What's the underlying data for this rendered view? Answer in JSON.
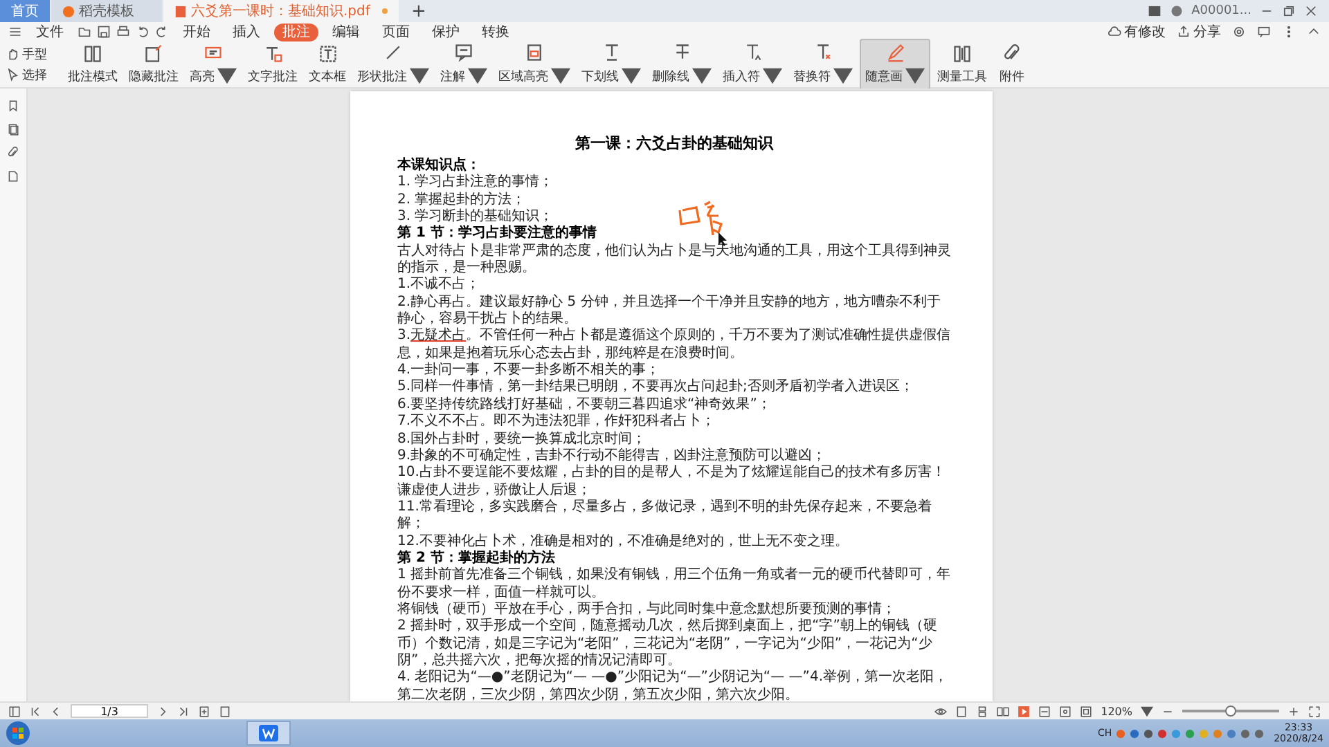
{
  "tabs": [
    {
      "label": "首页",
      "kind": "home",
      "selected": false
    },
    {
      "label": "稻壳模板",
      "kind": "template",
      "selected": false
    },
    {
      "label": "六爻第一课时：基础知识.pdf",
      "kind": "document",
      "selected": true
    }
  ],
  "new_tab": "+",
  "account": {
    "name": "A00001..."
  },
  "menu": {
    "label": "文件"
  },
  "ribbon_tabs": [
    {
      "label": "开始",
      "selected": false
    },
    {
      "label": "插入",
      "selected": false
    },
    {
      "label": "批注",
      "selected": true
    },
    {
      "label": "编辑",
      "selected": false
    },
    {
      "label": "页面",
      "selected": false
    },
    {
      "label": "保护",
      "selected": false
    },
    {
      "label": "转换",
      "selected": false
    }
  ],
  "right_actions": [
    {
      "label": "有修改"
    },
    {
      "label": "分享"
    }
  ],
  "small_tools": [
    {
      "label": "手型"
    },
    {
      "label": "选择"
    }
  ],
  "tools": [
    {
      "label": "批注模式",
      "dropdown": false,
      "selected": false
    },
    {
      "label": "隐藏批注",
      "dropdown": false,
      "selected": false
    },
    {
      "label": "高亮",
      "dropdown": true,
      "selected": false
    },
    {
      "label": "文字批注",
      "dropdown": false,
      "selected": false
    },
    {
      "label": "文本框",
      "dropdown": false,
      "selected": false
    },
    {
      "label": "形状批注",
      "dropdown": true,
      "selected": false
    },
    {
      "label": "注解",
      "dropdown": true,
      "selected": false
    },
    {
      "label": "区域高亮",
      "dropdown": true,
      "selected": false
    },
    {
      "label": "下划线",
      "dropdown": true,
      "selected": false
    },
    {
      "label": "删除线",
      "dropdown": true,
      "selected": false
    },
    {
      "label": "插入符",
      "dropdown": true,
      "selected": false
    },
    {
      "label": "替换符",
      "dropdown": true,
      "selected": false
    },
    {
      "label": "随意画",
      "dropdown": true,
      "selected": true
    },
    {
      "label": "测量工具",
      "dropdown": false,
      "selected": false
    },
    {
      "label": "附件",
      "dropdown": false,
      "selected": false
    }
  ],
  "document": {
    "title": "第一课：六爻占卦的基础知识",
    "blocks": [
      {
        "kind": "heading",
        "text": "本课知识点："
      },
      {
        "kind": "para",
        "text": "1.  学习占卦注意的事情；"
      },
      {
        "kind": "para",
        "text": "2.  掌握起卦的方法；"
      },
      {
        "kind": "para",
        "text": "3.  学习断卦的基础知识；"
      },
      {
        "kind": "heading",
        "text": "第 1 节：学习占卦要注意的事情"
      },
      {
        "kind": "para",
        "text": "古人对待占卜是非常严肃的态度，他们认为占卜是与天地沟通的工具，用这个工具得到神灵的指示，是一种恩赐。"
      },
      {
        "kind": "para",
        "text": "1.不诚不占；"
      },
      {
        "kind": "para",
        "text": "2.静心再占。建议最好静心 5 分钟，并且选择一个干净并且安静的地方，地方嘈杂不利于静心，容易干扰占卜的结果。"
      },
      {
        "kind": "marked",
        "prefix": "3.",
        "marked": "无疑术占",
        "text": "。不管任何一种占卜都是遵循这个原则的，千万不要为了测试准确性提供虚假信息，如果是抱着玩乐心态去占卦，那纯粹是在浪费时间。"
      },
      {
        "kind": "para",
        "text": "4.一卦问一事，不要一卦多断不相关的事；"
      },
      {
        "kind": "para",
        "text": "5.同样一件事情，第一卦结果已明朗，不要再次占问起卦;否则矛盾初学者入进误区；"
      },
      {
        "kind": "para",
        "text": "6.要坚持传统路线打好基础，不要朝三暮四追求“神奇效果”；"
      },
      {
        "kind": "para",
        "text": "7.不义不不占。即不为违法犯罪，作奸犯科者占卜；"
      },
      {
        "kind": "para",
        "text": "8.国外占卦时，要统一换算成北京时间；"
      },
      {
        "kind": "para",
        "text": "9.卦象的不可确定性，吉卦不行动不能得吉，凶卦注意预防可以避凶；"
      },
      {
        "kind": "para",
        "text": "10.占卦不要逞能不要炫耀，占卦的目的是帮人，不是为了炫耀逞能自己的技术有多厉害！谦虚使人进步，骄傲让人后退；"
      },
      {
        "kind": "para",
        "text": "11.常看理论，多实践磨合，尽量多占，多做记录，遇到不明的卦先保存起来，不要急着解；"
      },
      {
        "kind": "para",
        "text": "12.不要神化占卜术，准确是相对的，不准确是绝对的，世上无不变之理。"
      },
      {
        "kind": "heading",
        "text": "第 2 节：掌握起卦的方法"
      },
      {
        "kind": "para",
        "text": "1 摇卦前首先准备三个铜钱，如果没有铜钱，用三个伍角一角或者一元的硬币代替即可，年份不要求一样，面值一样就可以。"
      },
      {
        "kind": "para",
        "text": "将铜钱（硬币）平放在手心，两手合扣，与此同时集中意念默想所要预测的事情；"
      },
      {
        "kind": "para",
        "text": "2 摇卦时，双手形成一个空间，随意摇动几次，然后掷到桌面上，把“字”朝上的铜钱（硬币）个数记清，如是三字记为“老阳”，三花记为“老阴”，一字记为“少阳”，一花记为“少阴”，总共摇六次，把每次摇的情况记清即可。"
      },
      {
        "kind": "para",
        "text": "4.  老阳记为“—●”老阴记为“— —●”少阳记为“—”少阴记为“— —”4.举例，第一次老阳，第二次老阴，三次少阴，第四次少阴，第五次少阳，第六次少阳。"
      }
    ]
  },
  "status": {
    "page": "1/3",
    "zoom": "120%"
  },
  "zoom_slider": {
    "level": 0.5
  },
  "taskbar": {
    "language": "CH",
    "time": "23:33",
    "date": "2020/8/24"
  }
}
